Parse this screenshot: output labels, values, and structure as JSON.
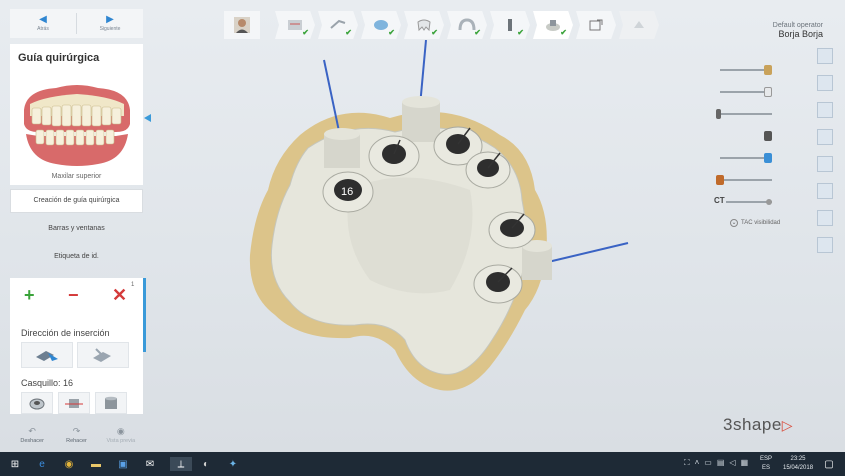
{
  "nav": {
    "back_label": "Atrás",
    "next_label": "Siguiente"
  },
  "panel": {
    "title": "Guía quirúrgica",
    "model_caption": "Maxilar superior",
    "menu": [
      {
        "label": "Creación de guía quirúrgica",
        "active": true
      },
      {
        "label": "Barras y ventanas",
        "active": false
      },
      {
        "label": "Etiqueta de id.",
        "active": false
      }
    ],
    "count_badge": "1",
    "insertion_heading": "Dirección de inserción",
    "sleeve_heading": "Casquillo: 16"
  },
  "bottom": {
    "undo": "Deshacer",
    "redo": "Rehacer",
    "preview": "Vista previa"
  },
  "operator": {
    "label": "Default operator",
    "name": "Borja Borja"
  },
  "sliders": {
    "ct_label": "CT",
    "tac_label": "TAC visibilidad"
  },
  "viewport": {
    "sleeve_label": "16"
  },
  "logo": {
    "text": "3shape"
  },
  "taskbar": {
    "lang1": "ESP",
    "lang2": "ES",
    "time": "23:25",
    "date": "15/04/2018"
  },
  "colors": {
    "accent": "#3a9ad9",
    "check": "#3aa33a",
    "danger": "#d43a3a",
    "guide": "#e6e6dc",
    "scan": "#dcc48a"
  }
}
